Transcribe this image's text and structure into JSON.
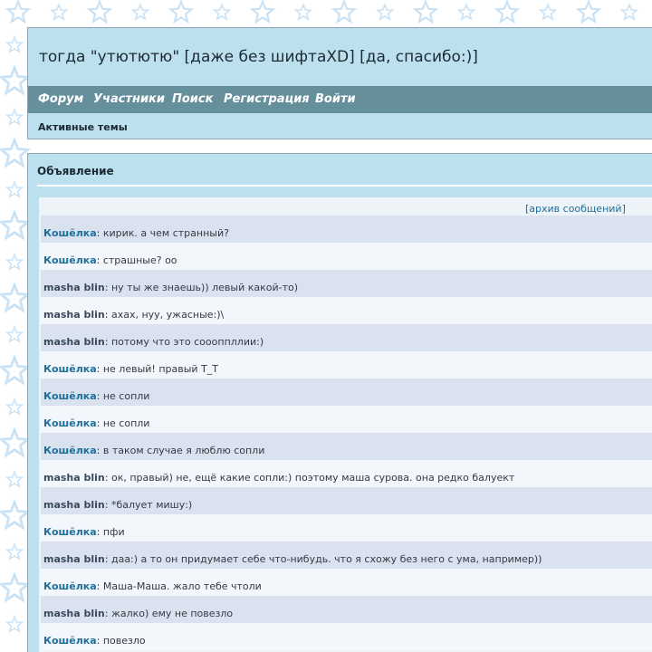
{
  "site": {
    "title": "тогда \"утютютю\" [даже без шифтаXD] [да, спасибо:)]"
  },
  "nav": {
    "items": [
      {
        "label": "Форум"
      },
      {
        "label": "Участники"
      },
      {
        "label": "Поиск"
      },
      {
        "label": "Регистрация"
      },
      {
        "label": "Войти"
      }
    ],
    "sub_label": "Активные темы"
  },
  "announcement": {
    "title": "Объявление",
    "archive_label": "[архив сообщений]",
    "messages": [
      {
        "author": "Кошёлка",
        "text": "кирик. а чем странный?"
      },
      {
        "author": "Кошёлка",
        "text": "страшные? оо"
      },
      {
        "author": "masha blin",
        "text": "ну ты же знаешь)) левый какой-то)"
      },
      {
        "author": "masha blin",
        "text": "ахах, нуу, ужасные:)\\"
      },
      {
        "author": "masha blin",
        "text": "потому что это соооппллии:)"
      },
      {
        "author": "Кошёлка",
        "text": "не левый! правый Т_Т"
      },
      {
        "author": "Кошёлка",
        "text": "не сопли"
      },
      {
        "author": "Кошёлка",
        "text": "не сопли"
      },
      {
        "author": "Кошёлка",
        "text": "в таком случае я люблю сопли"
      },
      {
        "author": "masha blin",
        "text": "ок, правый) не, ещё какие сопли:) поэтому маша сурова. она редко балуект"
      },
      {
        "author": "masha blin",
        "text": "*балует мишу:)"
      },
      {
        "author": "Кошёлка",
        "text": "пфи"
      },
      {
        "author": "masha blin",
        "text": "даа:) а то он придумает себе что-нибудь. что я схожу без него с ума, например))"
      },
      {
        "author": "Кошёлка",
        "text": "Маша-Маша. жало тебе чтоли"
      },
      {
        "author": "masha blin",
        "text": "жалко) ему не повезло"
      },
      {
        "author": "Кошёлка",
        "text": "повезло"
      }
    ]
  },
  "colors": {
    "header_bg": "#bde0ef",
    "nav_bg": "#668f9c",
    "row_odd": "#d9e2ee",
    "row_even": "#f3f6fa",
    "author_koshelka": "#1f6f9a",
    "author_masha": "#3a4a5e",
    "star": "#c9e2f5"
  },
  "icons": {
    "background_pattern": "star-icon"
  }
}
